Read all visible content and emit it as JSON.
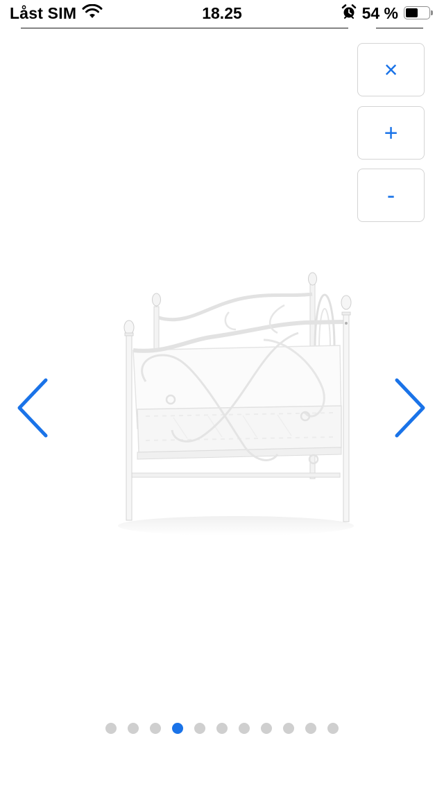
{
  "status_bar": {
    "carrier": "Låst SIM",
    "time": "18.25",
    "battery_percent": "54 %",
    "battery_level": 0.54,
    "icons": [
      "wifi-icon",
      "alarm-icon",
      "battery-icon"
    ]
  },
  "controls": {
    "close_label": "×",
    "zoom_in_label": "+",
    "zoom_out_label": "-"
  },
  "viewer": {
    "image_alt": "white-metal-daybed",
    "prev_icon": "chevron-left-icon",
    "next_icon": "chevron-right-icon",
    "accent_color": "#1a73e8",
    "total_images": 11,
    "current_index": 3
  }
}
